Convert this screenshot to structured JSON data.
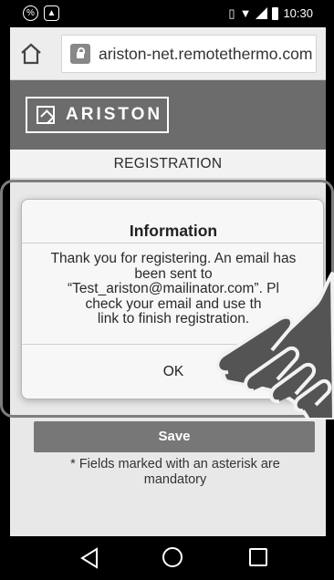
{
  "status_bar": {
    "time": "10:30",
    "colors": {
      "background": "#000000",
      "text": "#ffffff"
    }
  },
  "browser": {
    "url": "ariston-net.remotethermo.com"
  },
  "header": {
    "logo_text": "ARISTON"
  },
  "page": {
    "title": "REGISTRATION",
    "save_label": "Save",
    "footnote": "* Fields marked with an asterisk are mandatory"
  },
  "dialog": {
    "title": "Information",
    "message_lines": [
      "Thank you for registering. An email has",
      "been sent to",
      "“Test_ariston@mailinator.com”. Pl",
      "check your email and use th",
      "link to finish registration."
    ],
    "ok_label": "OK"
  },
  "icons": [
    "status-notification-icon",
    "gallery-icon",
    "vibrate-icon",
    "wifi-icon",
    "signal-icon",
    "battery-icon",
    "home-icon",
    "lock-icon",
    "ariston-house-icon",
    "back-icon",
    "nav-home-icon",
    "recent-apps-icon",
    "pointing-hand-icon"
  ],
  "colors": {
    "header": "#6c6c6c",
    "save_button": "#777777",
    "page_background": "#e8e8e8"
  }
}
